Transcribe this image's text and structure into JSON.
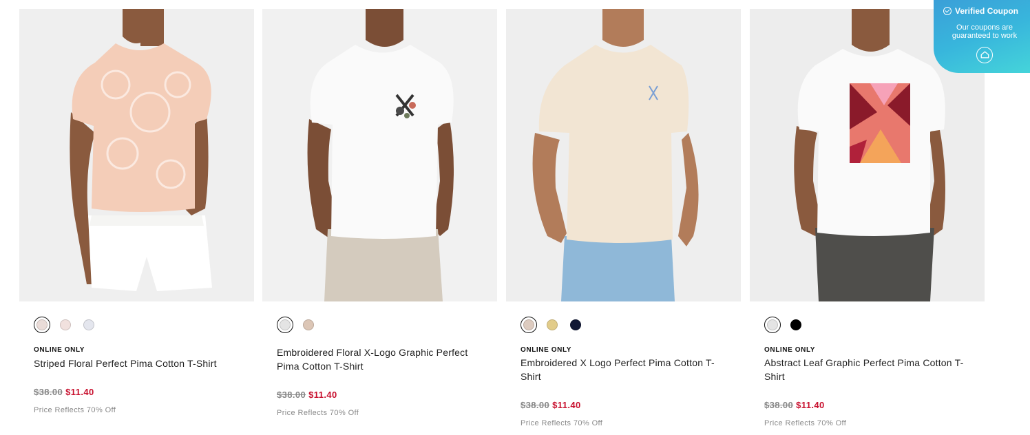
{
  "products": [
    {
      "badge": "ONLINE ONLY",
      "title": "Striped Floral Perfect Pima Cotton T-Shirt",
      "original_price": "$38.00",
      "sale_price": "$11.40",
      "price_note": "Price Reflects 70% Off",
      "swatches": [
        "#eadcd8",
        "#f1e1de",
        "#e4e6ee"
      ],
      "selected_swatch": 0
    },
    {
      "badge": "",
      "title": "Embroidered Floral X-Logo Graphic Perfect Pima Cotton T-Shirt",
      "original_price": "$38.00",
      "sale_price": "$11.40",
      "price_note": "Price Reflects 70% Off",
      "swatches": [
        "#e4e4e4",
        "#dcc6b6"
      ],
      "selected_swatch": 0
    },
    {
      "badge": "ONLINE ONLY",
      "title": "Embroidered X Logo Perfect Pima Cotton T-Shirt",
      "original_price": "$38.00",
      "sale_price": "$11.40",
      "price_note": "Price Reflects 70% Off",
      "swatches": [
        "#ddcbbf",
        "#e2cc8a",
        "#101734"
      ],
      "selected_swatch": 0
    },
    {
      "badge": "ONLINE ONLY",
      "title": "Abstract Leaf Graphic Perfect Pima Cotton T-Shirt",
      "original_price": "$38.00",
      "sale_price": "$11.40",
      "price_note": "Price Reflects 70% Off",
      "swatches": [
        "#e4e4e4",
        "#000000"
      ],
      "selected_swatch": 0
    }
  ],
  "coupon": {
    "title": "Verified Coupon",
    "subtitle": "Our coupons are guaranteed to work"
  },
  "colors": {
    "sale": "#c8102e",
    "original": "#888888",
    "coupon_gradient_start": "#3a9fd8",
    "coupon_gradient_end": "#45d4da"
  }
}
